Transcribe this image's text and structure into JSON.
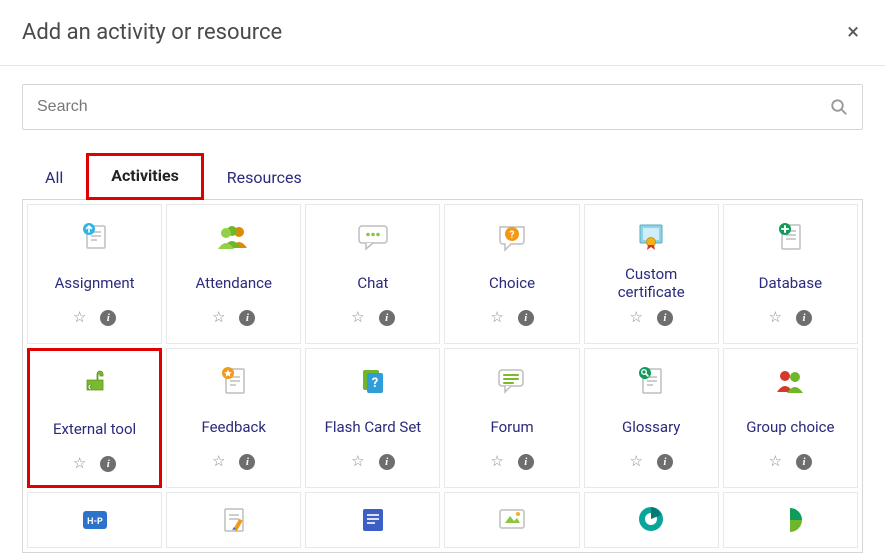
{
  "modal": {
    "title": "Add an activity or resource",
    "close_label": "×"
  },
  "search": {
    "placeholder": "Search"
  },
  "tabs": [
    {
      "key": "all",
      "label": "All",
      "active": false
    },
    {
      "key": "activities",
      "label": "Activities",
      "active": true,
      "highlighted": true
    },
    {
      "key": "resources",
      "label": "Resources",
      "active": false
    }
  ],
  "cards_row1": [
    {
      "key": "assignment",
      "label": "Assignment",
      "icon": "assignment-icon"
    },
    {
      "key": "attendance",
      "label": "Attendance",
      "icon": "attendance-icon"
    },
    {
      "key": "chat",
      "label": "Chat",
      "icon": "chat-icon"
    },
    {
      "key": "choice",
      "label": "Choice",
      "icon": "choice-icon"
    },
    {
      "key": "custom-certificate",
      "label": "Custom certificate",
      "icon": "certificate-icon"
    },
    {
      "key": "database",
      "label": "Database",
      "icon": "database-icon"
    }
  ],
  "cards_row2": [
    {
      "key": "external-tool",
      "label": "External tool",
      "icon": "external-tool-icon",
      "highlighted": true
    },
    {
      "key": "feedback",
      "label": "Feedback",
      "icon": "feedback-icon"
    },
    {
      "key": "flash-card-set",
      "label": "Flash Card Set",
      "icon": "flash-card-icon"
    },
    {
      "key": "forum",
      "label": "Forum",
      "icon": "forum-icon"
    },
    {
      "key": "glossary",
      "label": "Glossary",
      "icon": "glossary-icon"
    },
    {
      "key": "group-choice",
      "label": "Group choice",
      "icon": "group-choice-icon"
    }
  ],
  "cards_row3_partial": [
    {
      "key": "h5p",
      "icon": "h5p-icon"
    },
    {
      "key": "lesson",
      "icon": "lesson-icon"
    },
    {
      "key": "quiz",
      "icon": "quiz-icon"
    },
    {
      "key": "scorm",
      "icon": "scorm-icon"
    },
    {
      "key": "survey",
      "icon": "survey-icon"
    },
    {
      "key": "workshop",
      "icon": "workshop-icon"
    }
  ],
  "colors": {
    "link": "#2b2a7c",
    "highlight": "#e00000"
  }
}
